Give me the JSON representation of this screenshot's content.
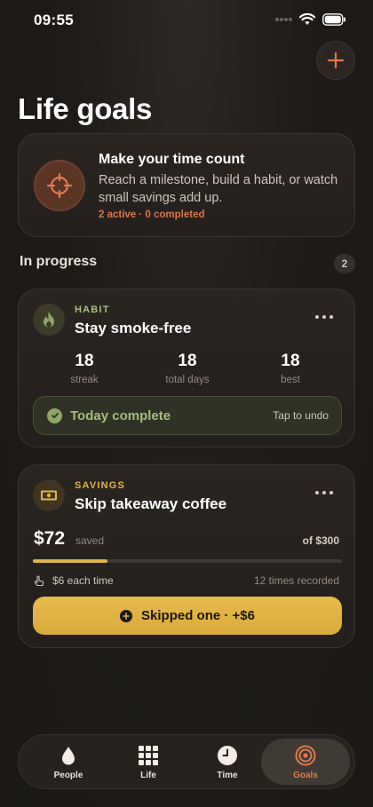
{
  "status": {
    "time": "09:55"
  },
  "header": {
    "title": "Life goals"
  },
  "intro": {
    "title": "Make your time count",
    "description": "Reach a milestone, build a habit, or watch small savings add up.",
    "stats": "2 active · 0 completed"
  },
  "section": {
    "label": "In progress",
    "count": "2"
  },
  "habit": {
    "kind": "HABIT",
    "name": "Stay smoke-free",
    "stats": [
      {
        "value": "18",
        "label": "streak"
      },
      {
        "value": "18",
        "label": "total days"
      },
      {
        "value": "18",
        "label": "best"
      }
    ],
    "done_label": "Today complete",
    "undo_label": "Tap to undo"
  },
  "savings": {
    "kind": "SAVINGS",
    "name": "Skip takeaway coffee",
    "saved_amount": "$72",
    "saved_label": "saved",
    "target_label": "of $300",
    "progress_fraction": 0.24,
    "per_time": "$6 each time",
    "times_recorded": "12 times recorded",
    "button_label": "Skipped one · +$6"
  },
  "tabs": [
    {
      "label": "People",
      "icon": "drop-icon",
      "active": false
    },
    {
      "label": "Life",
      "icon": "grid-icon",
      "active": false
    },
    {
      "label": "Time",
      "icon": "clock-icon",
      "active": false
    },
    {
      "label": "Goals",
      "icon": "target-icon",
      "active": true
    }
  ],
  "colors": {
    "accent_orange": "#d9764b",
    "habit_green": "#a8bd7e",
    "savings_gold": "#e0b44a",
    "background": "#1e1b18"
  }
}
